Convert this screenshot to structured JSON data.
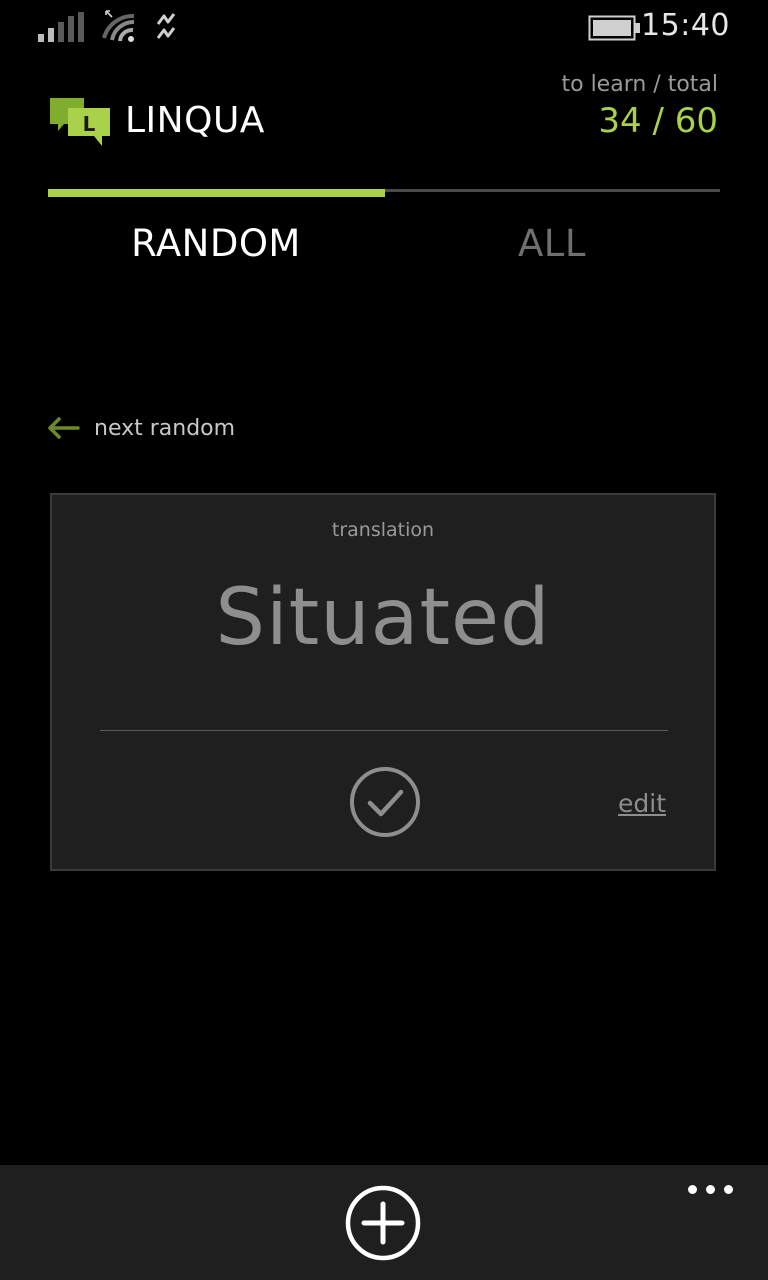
{
  "status_bar": {
    "time": "15:40",
    "icons": [
      "signal-strength-icon",
      "wifi-icon",
      "data-sync-icon",
      "battery-icon"
    ]
  },
  "header": {
    "app_name": "LINQUA",
    "logo_letter": "L",
    "counter_label": "to learn / total",
    "counter_value": "34 / 60"
  },
  "tabs": [
    {
      "label": "RANDOM",
      "selected": true
    },
    {
      "label": "ALL",
      "selected": false
    }
  ],
  "next_random": {
    "label": "next random",
    "icon": "arrow-left-icon"
  },
  "card": {
    "caption": "translation",
    "word": "Situated",
    "check_icon": "check-circle-icon",
    "edit_label": "edit"
  },
  "app_bar": {
    "add_icon": "plus-circle-icon",
    "more_icon": "ellipsis-icon"
  },
  "colors": {
    "accent": "#a9d24a",
    "background": "#000000",
    "card_background": "#1f1f1f",
    "muted_text": "#8e8e8e"
  }
}
